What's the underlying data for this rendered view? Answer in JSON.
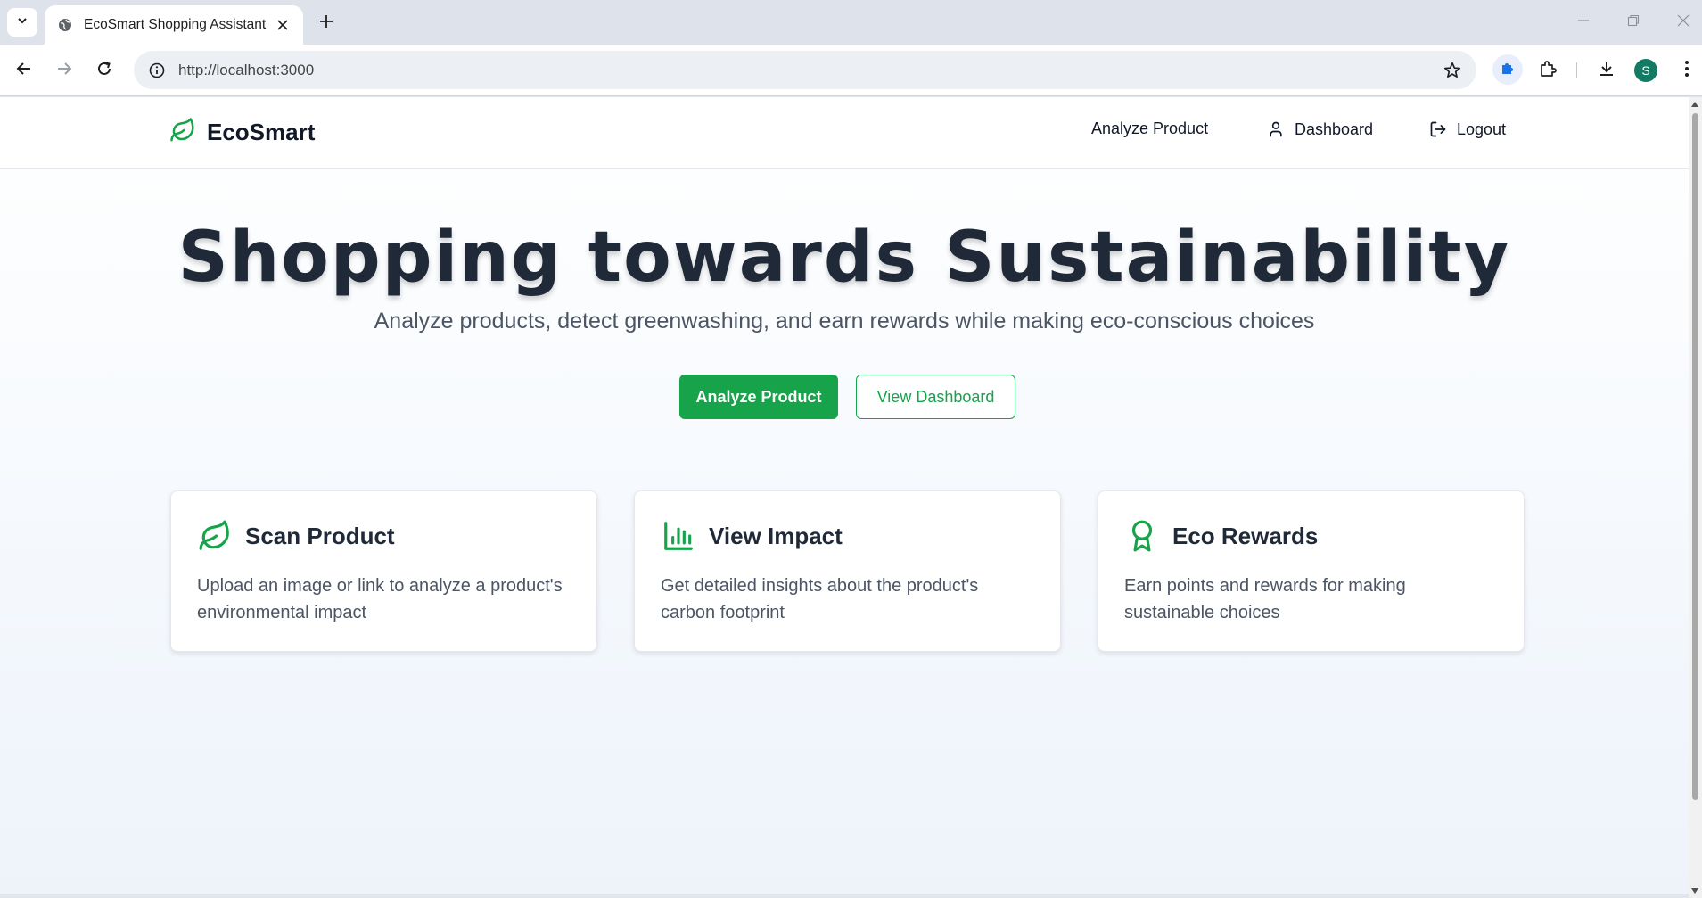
{
  "browser": {
    "tab_title": "EcoSmart Shopping Assistant",
    "url": "http://localhost:3000",
    "profile_initial": "S"
  },
  "nav": {
    "brand": "EcoSmart",
    "links": [
      {
        "label": "Analyze Product",
        "icon": "none"
      },
      {
        "label": "Dashboard",
        "icon": "user-icon"
      },
      {
        "label": "Logout",
        "icon": "logout-icon"
      }
    ]
  },
  "hero": {
    "title": "Shopping towards Sustainability",
    "subtitle": "Analyze products, detect greenwashing, and earn rewards while making eco-conscious choices",
    "primary_button": "Analyze Product",
    "secondary_button": "View Dashboard"
  },
  "features": [
    {
      "icon": "leaf-icon",
      "title": "Scan Product",
      "description": "Upload an image or link to analyze a product's environmental impact"
    },
    {
      "icon": "bar-chart-icon",
      "title": "View Impact",
      "description": "Get detailed insights about the product's carbon footprint"
    },
    {
      "icon": "award-icon",
      "title": "Eco Rewards",
      "description": "Earn points and rewards for making sustainable choices"
    }
  ],
  "colors": {
    "accent": "#16a34a",
    "heading": "#1f2937",
    "body_text": "#4b5563"
  }
}
